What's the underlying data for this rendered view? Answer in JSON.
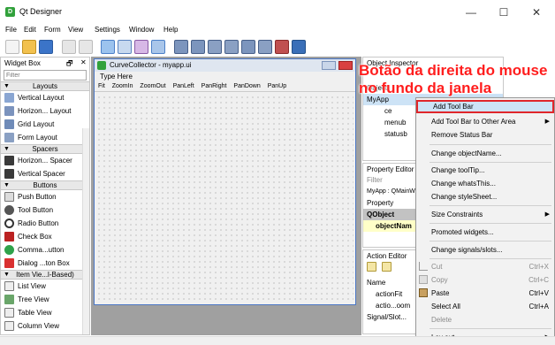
{
  "app": {
    "icon_text": "D",
    "title": "Qt Designer"
  },
  "window_controls": {
    "minimize": "—",
    "maximize": "☐",
    "close": "✕"
  },
  "menu": [
    "File",
    "Edit",
    "Form",
    "View",
    "Settings",
    "Window",
    "Help"
  ],
  "widget_box": {
    "title": "Widget Box",
    "filter_placeholder": "Filter",
    "controls": {
      "float": "🗗",
      "close": "✕"
    },
    "categories": {
      "layouts": "Layouts",
      "spacers": "Spacers",
      "buttons": "Buttons",
      "item_views": "Item Vie...l-Based)"
    },
    "layouts": [
      "Vertical Layout",
      "Horizon... Layout",
      "Grid Layout",
      "Form Layout"
    ],
    "spacers": [
      "Horizon... Spacer",
      "Vertical Spacer"
    ],
    "buttons": [
      "Push Button",
      "Tool Button",
      "Radio Button",
      "Check Box",
      "Comma...utton",
      "Dialog ...ton Box"
    ],
    "item_views": [
      "List View",
      "Tree View",
      "Table View",
      "Column View"
    ]
  },
  "form": {
    "title": "CurveCollector - myapp.ui",
    "type_here": "Type Here",
    "toolbar_items": [
      "Fit",
      "ZoomIn",
      "ZoomOut",
      "PanLeft",
      "PanRight",
      "PanDown",
      "PanUp"
    ]
  },
  "object_inspector": {
    "title": "Object Inspector",
    "controls": "🗗 ✕",
    "rows": [
      "Object",
      "MyApp",
      "ce",
      "menub",
      "statusb",
      "v...Ct..."
    ]
  },
  "property_editor": {
    "title": "Property Editor",
    "filter_placeholder": "Filter",
    "context_label": "MyApp : QMainW",
    "header": "Property",
    "group": "QObject",
    "row": "objectNam"
  },
  "action_editor": {
    "title": "Action Editor",
    "header": "Name",
    "rows": [
      "actionFit",
      "actio...oom"
    ]
  },
  "signal_slot": {
    "tab": "Signal/Slot..."
  },
  "annotation": {
    "line1": "Botão da direita do mouse",
    "line2": "no fundo da janela"
  },
  "context_menu": {
    "items": [
      {
        "label": "Add Tool Bar",
        "shortcut": "",
        "submenu": false,
        "disabled": false,
        "highlighted": true
      },
      {
        "label": "Add Tool Bar to Other Area",
        "shortcut": "",
        "submenu": true,
        "disabled": false
      },
      {
        "label": "Remove Status Bar",
        "shortcut": "",
        "submenu": false,
        "disabled": false
      },
      {
        "label": "Change objectName...",
        "shortcut": "",
        "submenu": false,
        "disabled": false
      },
      {
        "label": "Change toolTip...",
        "shortcut": "",
        "submenu": false,
        "disabled": false
      },
      {
        "label": "Change whatsThis...",
        "shortcut": "",
        "submenu": false,
        "disabled": false
      },
      {
        "label": "Change styleSheet...",
        "shortcut": "",
        "submenu": false,
        "disabled": false
      },
      {
        "label": "Size Constraints",
        "shortcut": "",
        "submenu": true,
        "disabled": false
      },
      {
        "label": "Promoted widgets...",
        "shortcut": "",
        "submenu": false,
        "disabled": false
      },
      {
        "label": "Change signals/slots...",
        "shortcut": "",
        "submenu": false,
        "disabled": false
      },
      {
        "label": "Cut",
        "shortcut": "Ctrl+X",
        "submenu": false,
        "disabled": true
      },
      {
        "label": "Copy",
        "shortcut": "Ctrl+C",
        "submenu": false,
        "disabled": true
      },
      {
        "label": "Paste",
        "shortcut": "Ctrl+V",
        "submenu": false,
        "disabled": false
      },
      {
        "label": "Select All",
        "shortcut": "Ctrl+A",
        "submenu": false,
        "disabled": false
      },
      {
        "label": "Delete",
        "shortcut": "",
        "submenu": false,
        "disabled": true
      },
      {
        "label": "Lay out",
        "shortcut": "",
        "submenu": true,
        "disabled": false
      }
    ],
    "submenu_arrow": "▶"
  },
  "colors": {
    "accent_red": "#e0262b",
    "annotation_red": "#ff1d1d",
    "selection_blue": "#cde3f6",
    "qt_green": "#31a13b"
  }
}
